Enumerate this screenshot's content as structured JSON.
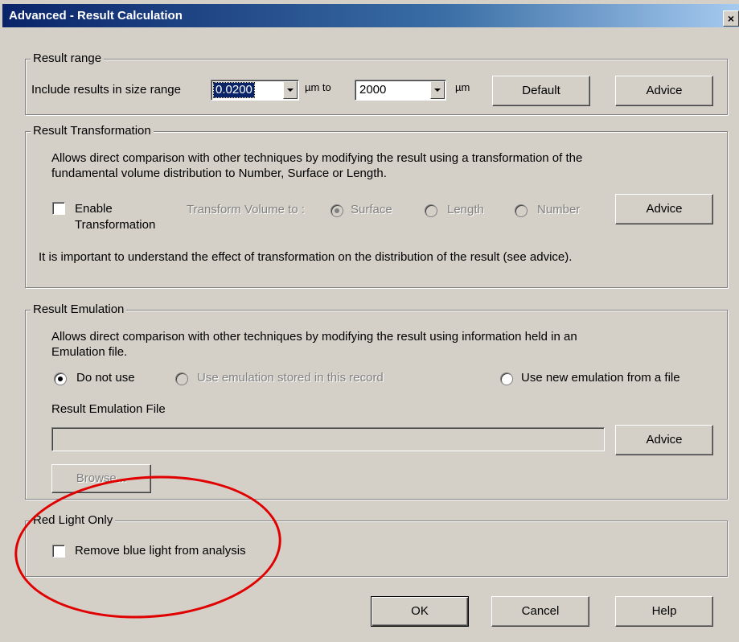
{
  "window": {
    "title": "Advanced - Result Calculation",
    "close_glyph": "×"
  },
  "result_range": {
    "group_label": "Result range",
    "include_label": "Include results in size range",
    "min_value": "0.0200",
    "mid_label": "µm to",
    "max_value": "2000",
    "unit_label": "µm",
    "default_button": "Default",
    "advice_button": "Advice"
  },
  "result_transformation": {
    "group_label": "Result Transformation",
    "description_line1": "Allows direct comparison with other techniques by modifying the result using a transformation of the",
    "description_line2": "fundamental volume distribution to Number, Surface or Length.",
    "enable_line1": "Enable",
    "enable_line2": "Transformation",
    "transform_label": "Transform Volume to :",
    "options": [
      "Surface",
      "Length",
      "Number"
    ],
    "selected_option": "Surface",
    "advice_button": "Advice",
    "note": "It is important to understand the effect of transformation on the distribution of the result (see advice)."
  },
  "result_emulation": {
    "group_label": "Result Emulation",
    "description_line1": "Allows direct comparison with other techniques by modifying the result using information held in an",
    "description_line2": "Emulation file.",
    "options": [
      "Do not use",
      "Use emulation stored in this record",
      "Use new emulation from a file"
    ],
    "selected_option": "Do not use",
    "file_label": "Result Emulation File",
    "file_value": "",
    "advice_button": "Advice",
    "browse_button": "Browse..."
  },
  "red_light": {
    "group_label": "Red Light Only",
    "checkbox_label": "Remove blue light from analysis",
    "checked": false
  },
  "footer": {
    "ok": "OK",
    "cancel": "Cancel",
    "help": "Help"
  },
  "colors": {
    "titlebar": "#0a246a",
    "dialog_bg": "#d4d0c8",
    "annotation": "#e00000"
  }
}
